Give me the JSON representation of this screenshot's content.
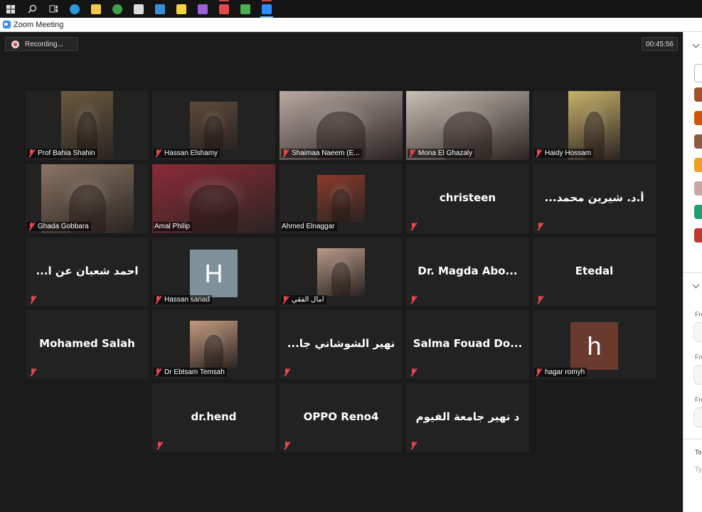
{
  "window": {
    "title": "Zoom Meeting"
  },
  "taskbar": {
    "icons": [
      {
        "name": "windows-start-icon",
        "color": "#4aa3f0"
      },
      {
        "name": "search-icon",
        "color": "#dddddd"
      },
      {
        "name": "task-view-icon",
        "color": "#dddddd"
      },
      {
        "name": "edge-icon",
        "color": "#2a9bd8"
      },
      {
        "name": "file-explorer-icon",
        "color": "#f2c84b"
      },
      {
        "name": "chrome-icon",
        "color": "#3fa34d"
      },
      {
        "name": "store-icon",
        "color": "#dddddd"
      },
      {
        "name": "mail-icon",
        "color": "#3b8fd8"
      },
      {
        "name": "sticky-notes-icon",
        "color": "#f7d23a"
      },
      {
        "name": "visual-studio-icon",
        "color": "#9b5fd6"
      },
      {
        "name": "app-icon",
        "color": "#e5484d"
      },
      {
        "name": "green-app-icon",
        "color": "#4caf50"
      },
      {
        "name": "zoom-icon",
        "color": "#2d8cff"
      }
    ]
  },
  "meeting": {
    "recording_label": "Recording...",
    "elapsed_time": "00:45:56"
  },
  "participants": [
    {
      "name": "Prof Bahia Shahin",
      "type": "video",
      "muted": true,
      "video_color": "#6a5a3e"
    },
    {
      "name": "Hassan Elshamy",
      "type": "video",
      "muted": true,
      "video_color": "#5e4a3a"
    },
    {
      "name": "Shaimaa Naeem (E...",
      "type": "video",
      "muted": true,
      "video_color": "#b9a9a3"
    },
    {
      "name": "Mona El Ghazaly",
      "type": "video",
      "muted": true,
      "video_color": "#c9bfb5"
    },
    {
      "name": "Haidy Hossam",
      "type": "video",
      "muted": true,
      "video_color": "#c8b26a"
    },
    {
      "name": "Ghada Gobbara",
      "type": "video",
      "muted": true,
      "video_color": "#8a7564"
    },
    {
      "name": "Amal Philip",
      "type": "video",
      "muted": false,
      "speaking": true,
      "video_color": "#8c2b38"
    },
    {
      "name": "Ahmed Elnaggar",
      "type": "video",
      "muted": false,
      "video_color": "#8b3a2a"
    },
    {
      "name": "christeen",
      "type": "text",
      "muted": true
    },
    {
      "name": "...أ.د. شيرين محمد",
      "type": "text",
      "muted": true
    },
    {
      "name": "...احمد شعبان عن ا",
      "type": "text",
      "muted": true
    },
    {
      "name": "Hassan sanad",
      "type": "avatar",
      "letter": "H",
      "avatar_color": "#7f929c",
      "muted": true
    },
    {
      "name": "امال الفقي",
      "type": "video",
      "muted": true,
      "video_color": "#b79a86"
    },
    {
      "name": "Dr. Magda Abo...",
      "type": "text",
      "muted": true
    },
    {
      "name": "Etedal",
      "type": "text",
      "muted": true
    },
    {
      "name": "Mohamed Salah",
      "type": "text",
      "muted": true
    },
    {
      "name": "Dr Ebtsam Temsah",
      "type": "video",
      "muted": true,
      "video_color": "#c49b7e"
    },
    {
      "name": "...نهير الشوشاني جا",
      "type": "text",
      "muted": true
    },
    {
      "name": "Salma Fouad Do...",
      "type": "text",
      "muted": true
    },
    {
      "name": "hagar romyh",
      "type": "avatar",
      "letter": "h",
      "avatar_color": "#6b3a2e",
      "muted": true
    },
    {
      "name": "dr.hend",
      "type": "text",
      "muted": true
    },
    {
      "name": "OPPO Reno4",
      "type": "text",
      "muted": true
    },
    {
      "name": "د نهير جامعة الفيوم",
      "type": "text",
      "muted": true
    }
  ],
  "side_panel": {
    "avatars": [
      "#a0522d",
      "#d35400",
      "#8e5a3c",
      "#f0a020",
      "#c9a6a0",
      "#20a070",
      "#c0392b"
    ],
    "from_labels": [
      "Fro",
      "Fro",
      "Fro"
    ],
    "to_label": "To:",
    "type_placeholder": "Typ"
  }
}
